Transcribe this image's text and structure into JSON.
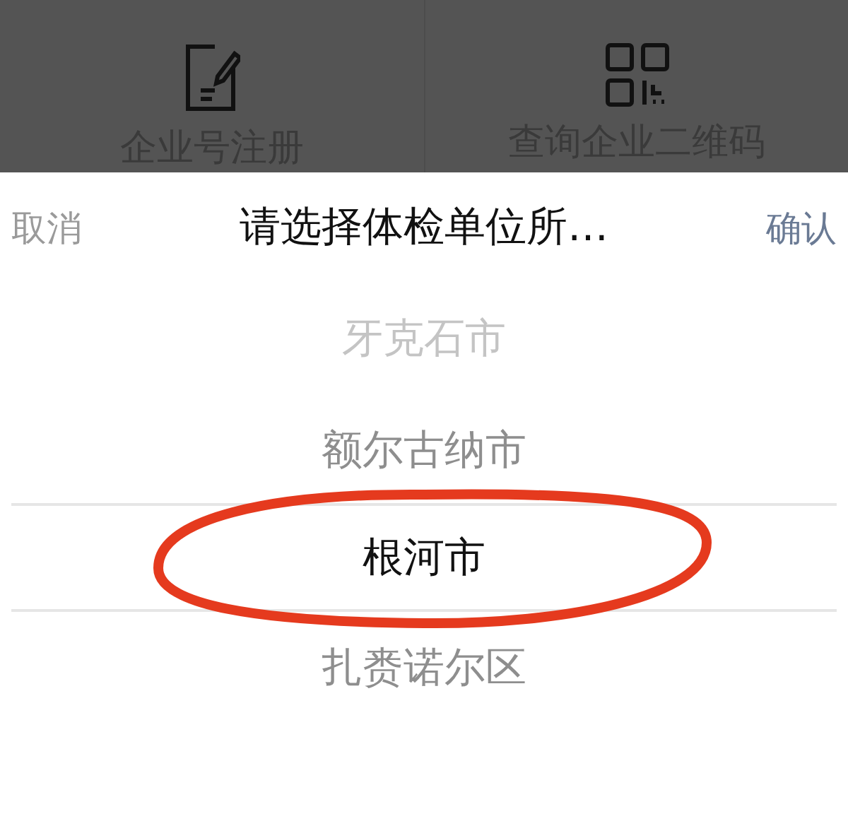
{
  "background_menu": {
    "items": [
      {
        "label": "企业号注册",
        "kind": "register"
      },
      {
        "label": "查询企业二维码",
        "kind": "qrcode"
      }
    ]
  },
  "picker": {
    "cancel": "取消",
    "title": "请选择体检单位所…",
    "confirm": "确认",
    "options": [
      {
        "label": "牙克石市",
        "selected": false
      },
      {
        "label": "额尔古纳市",
        "selected": false
      },
      {
        "label": "根河市",
        "selected": true
      },
      {
        "label": "扎赉诺尔区",
        "selected": false
      }
    ]
  }
}
